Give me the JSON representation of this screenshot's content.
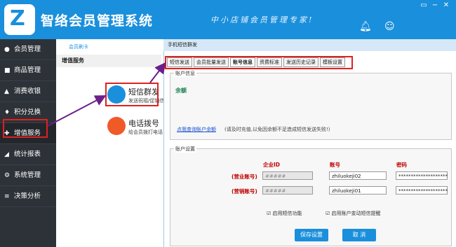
{
  "app": {
    "title": "智络会员管理系统",
    "slogan": "中小店铺会员管理专家!",
    "window_buttons": [
      "▭",
      "−",
      "✕"
    ]
  },
  "sidebar": {
    "items": [
      {
        "label": "会员管理",
        "icon": "user-icon"
      },
      {
        "label": "商品管理",
        "icon": "box-icon"
      },
      {
        "label": "消费收银",
        "icon": "cart-icon"
      },
      {
        "label": "积分兑换",
        "icon": "gift-icon"
      },
      {
        "label": "增值服务",
        "icon": "plus-icon"
      },
      {
        "label": "统计报表",
        "icon": "chart-icon"
      },
      {
        "label": "系统管理",
        "icon": "gear-icon"
      },
      {
        "label": "决策分析",
        "icon": "bar-icon"
      }
    ]
  },
  "secondary": {
    "crumb": "会员刷卡",
    "header": "增值服务",
    "services": [
      {
        "title": "短信群发",
        "sub": "发送祝福/促销信",
        "color": "#1a8fdc"
      },
      {
        "title": "电话拨号",
        "sub": "给会员拨打电话",
        "color": "#f05a28"
      }
    ]
  },
  "dialog": {
    "title": "手机短信群发",
    "tabs": [
      "短信发送",
      "会员批量发送",
      "账号信息",
      "资费标准",
      "发送历史记录",
      "模板设置"
    ],
    "active_tab": 2,
    "account_info": {
      "title": "账户信息",
      "balance_label": "余额",
      "query_link": "点我查询账户余额",
      "notice": "(请及时充值,以免因余额不足造成短信发送失败!)"
    },
    "account_settings": {
      "title": "账户设置",
      "col_enterprise": "企业ID",
      "col_account": "账号",
      "col_password": "密码",
      "rows": [
        {
          "label": "(营业账号)",
          "enterprise": "#####",
          "account": "zhiluokeji02",
          "password": "********************"
        },
        {
          "label": "(营销账号)",
          "enterprise": "#####",
          "account": "zhiluokeji01",
          "password": "********************"
        }
      ],
      "checkbox1": "启用短信功能",
      "checkbox2": "启用账户变动短信提醒",
      "save_label": "保存设置",
      "cancel_label": "取 消"
    }
  },
  "colors": {
    "accent": "#1a8fdc",
    "highlight": "#e02020",
    "arrow": "#6b1f8a"
  }
}
